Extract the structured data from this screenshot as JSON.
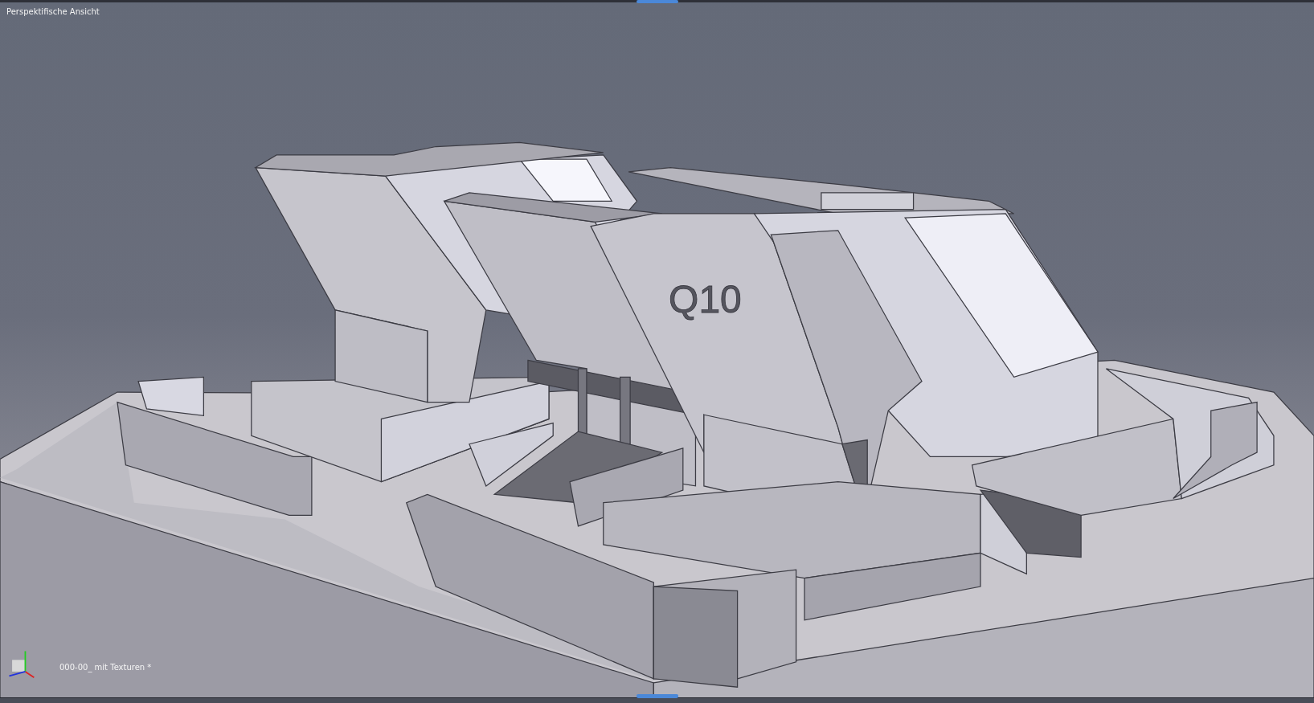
{
  "view": {
    "title": "Perspektifische Ansicht"
  },
  "model": {
    "label": "Q10"
  },
  "document": {
    "name": "000-00_ mit Texturen *"
  }
}
